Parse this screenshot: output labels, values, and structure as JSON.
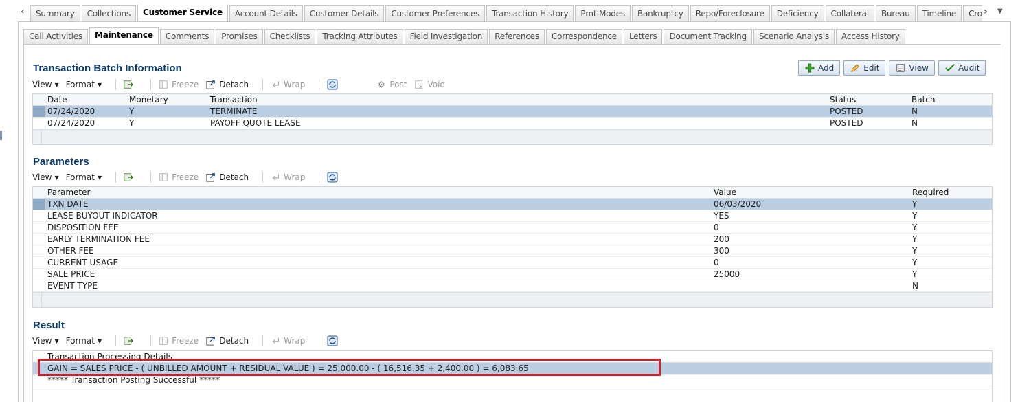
{
  "outer_tabs": [
    "Summary",
    "Collections",
    "Customer Service",
    "Account Details",
    "Customer Details",
    "Customer Preferences",
    "Transaction History",
    "Pmt Modes",
    "Bankruptcy",
    "Repo/Foreclosure",
    "Deficiency",
    "Collateral",
    "Bureau",
    "Timeline",
    "Cross/Up Sell"
  ],
  "outer_active": "Customer Service",
  "inner_tabs": [
    "Call Activities",
    "Maintenance",
    "Comments",
    "Promises",
    "Checklists",
    "Tracking Attributes",
    "Field Investigation",
    "References",
    "Correspondence",
    "Letters",
    "Document Tracking",
    "Scenario Analysis",
    "Access History"
  ],
  "inner_active": "Maintenance",
  "toolbar": {
    "view": "View",
    "format": "Format",
    "freeze": "Freeze",
    "detach": "Detach",
    "wrap": "Wrap",
    "post": "Post",
    "void": "Void"
  },
  "actions": {
    "add": "Add",
    "edit": "Edit",
    "view": "View",
    "audit": "Audit"
  },
  "transaction_batch": {
    "title": "Transaction Batch Information",
    "columns": [
      "Date",
      "Monetary",
      "Transaction",
      "Status",
      "Batch"
    ],
    "rows": [
      [
        "07/24/2020",
        "Y",
        "TERMINATE",
        "POSTED",
        "N"
      ],
      [
        "07/24/2020",
        "Y",
        "PAYOFF QUOTE LEASE",
        "POSTED",
        "N"
      ]
    ]
  },
  "parameters": {
    "title": "Parameters",
    "columns": [
      "Parameter",
      "Value",
      "Required"
    ],
    "rows": [
      [
        "TXN DATE",
        "06/03/2020",
        "Y"
      ],
      [
        "LEASE BUYOUT INDICATOR",
        "YES",
        "Y"
      ],
      [
        "DISPOSITION FEE",
        "0",
        "Y"
      ],
      [
        "EARLY TERMINATION FEE",
        "200",
        "Y"
      ],
      [
        "OTHER FEE",
        "300",
        "Y"
      ],
      [
        "CURRENT USAGE",
        "0",
        "Y"
      ],
      [
        "SALE PRICE",
        "25000",
        "Y"
      ],
      [
        "EVENT TYPE",
        "",
        "N"
      ]
    ]
  },
  "result": {
    "title": "Result",
    "column": "Transaction Processing Details",
    "rows": [
      "GAIN = SALES PRICE - ( UNBILLED AMOUNT + RESIDUAL VALUE ) = 25,000.00 - ( 16,516.35 + 2,400.00 ) = 6,083.65",
      "***** Transaction Posting Successful *****"
    ]
  },
  "colors": {
    "accent": "#0b3a6b",
    "selected_row": "#b9cde3",
    "highlight": "#d1202a"
  }
}
